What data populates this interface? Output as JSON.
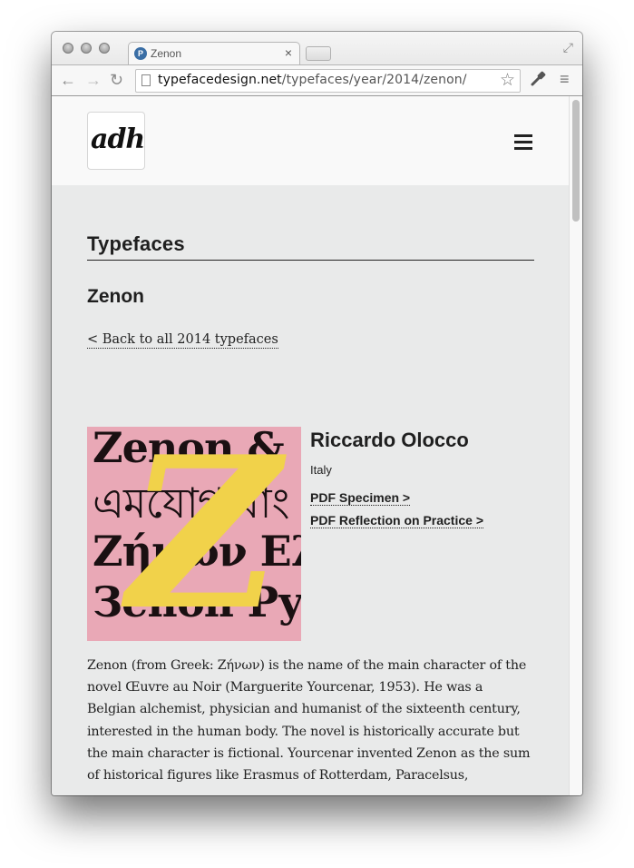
{
  "browser": {
    "tab": {
      "title": "Zenon",
      "favicon": "site-favicon",
      "close_glyph": "×"
    },
    "nav": {
      "back_glyph": "←",
      "forward_glyph": "→",
      "reload_glyph": "↻"
    },
    "address": {
      "host": "typefacedesign.net",
      "path": "/typefaces/year/2014/zenon/"
    },
    "icons": {
      "star_glyph": "☆",
      "wrench_glyph": "🔧",
      "menu_glyph": "≡",
      "fullscreen_glyph": "⤢"
    }
  },
  "site": {
    "logo_text": "adh",
    "menu_icon": "hamburger-icon"
  },
  "page": {
    "section_title": "Typefaces",
    "title": "Zenon",
    "back_link": "< Back to all 2014 typefaces",
    "specimen": {
      "lines": [
        "Zenon &",
        "এমযোগ বাং",
        "Ζήνων Ελ",
        "Зенон Ру"
      ],
      "big_letter": "Z",
      "background": "#e9a8b6",
      "accent": "#f1d24a"
    },
    "designer": {
      "name": "Riccardo Olocco",
      "country": "Italy",
      "pdf_specimen": "PDF Specimen >",
      "pdf_reflection": "PDF Reflection on Practice >"
    },
    "description": "Zenon (from Greek: Ζήνων) is the name of the main character of the novel Œuvre au Noir (Marguerite Yourcenar, 1953). He was a Belgian alchemist, physician and humanist of the sixteenth century, interested in the human body. The novel is historically accurate but the main character is fictional. Yourcenar invented Zenon as the sum of historical figures like Erasmus of Rotterdam, Paracelsus,"
  }
}
